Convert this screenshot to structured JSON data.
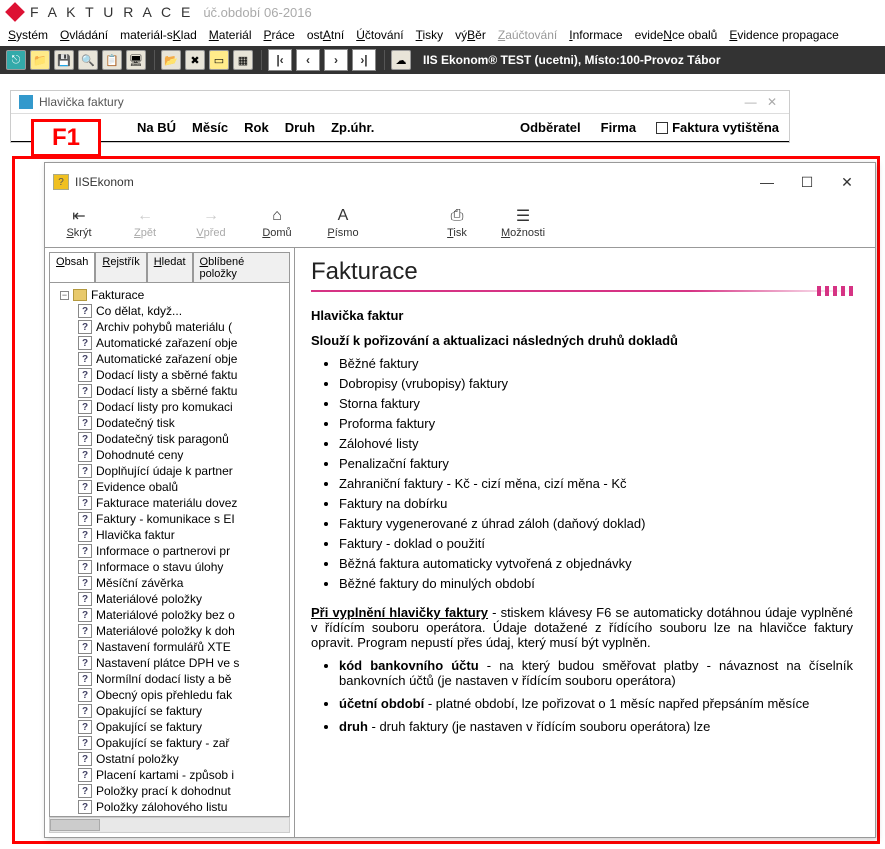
{
  "app": {
    "title": "F A K T U R A C E",
    "period": "úč.období 06-2016"
  },
  "menu": {
    "items": [
      {
        "label": "Systém",
        "u": "S"
      },
      {
        "label": "Ovládání",
        "u": "O"
      },
      {
        "label": "materiál-sKlad",
        "u": "K"
      },
      {
        "label": "Materiál",
        "u": "M"
      },
      {
        "label": "Práce",
        "u": "P"
      },
      {
        "label": "ostAtní",
        "u": "A"
      },
      {
        "label": "Účtování",
        "u": "Ú"
      },
      {
        "label": "Tisky",
        "u": "T"
      },
      {
        "label": "výBěr",
        "u": "B"
      },
      {
        "label": "Zaúčtování",
        "u": "Z",
        "disabled": true
      },
      {
        "label": "Informace",
        "u": "I"
      },
      {
        "label": "evideNce obalů",
        "u": "N"
      },
      {
        "label": "Evidence propagace",
        "u": "E"
      }
    ]
  },
  "dark_toolbar": {
    "status": "IIS Ekonom® TEST (ucetni), Místo:100-Provoz Tábor"
  },
  "hlavicka": {
    "window_title": "Hlavička faktury",
    "cols": [
      "Na BÚ",
      "Měsíc",
      "Rok",
      "Druh",
      "Zp.úhr."
    ],
    "right_cols": [
      "Odběratel",
      "Firma"
    ],
    "checkbox": "Faktura vytištěna",
    "f1": "F1"
  },
  "help": {
    "window_title": "IISEkonom",
    "toolbar": [
      {
        "label": "Skrýt",
        "icon": "⇤",
        "enabled": true
      },
      {
        "label": "Zpět",
        "icon": "←",
        "enabled": false
      },
      {
        "label": "Vpřed",
        "icon": "→",
        "enabled": false
      },
      {
        "label": "Domů",
        "icon": "⌂",
        "enabled": true
      },
      {
        "label": "Písmo",
        "icon": "A",
        "enabled": true
      },
      {
        "label": "Tisk",
        "icon": "⎙",
        "enabled": true
      },
      {
        "label": "Možnosti",
        "icon": "☰",
        "enabled": true
      }
    ],
    "tabs": [
      "Obsah",
      "Rejstřík",
      "Hledat",
      "Oblíbené položky"
    ],
    "tree_root": "Fakturace",
    "tree_items": [
      "Co dělat, když...",
      "Archiv pohybů materiálu (",
      "Automatické zařazení obje",
      "Automatické zařazení obje",
      "Dodací listy a sběrné faktu",
      "Dodací listy a sběrné faktu",
      "Dodací listy pro komukaci",
      "Dodatečný tisk",
      "Dodatečný tisk paragonů",
      "Dohodnuté ceny",
      "Doplňující údaje k partner",
      "Evidence obalů",
      "Fakturace materiálu dovez",
      "Faktury - komunikace s EI",
      "Hlavička faktur",
      "Informace o partnerovi pr",
      "Informace o stavu úlohy",
      "Měsíční závěrka",
      "Materiálové položky",
      "Materiálové položky bez o",
      "Materiálové položky k doh",
      "Nastavení formulářů XTE",
      "Nastavení plátce DPH ve s",
      "Normílní dodací listy a bě",
      "Obecný opis přehledu fak",
      "Opakující se faktury",
      "Opakující se faktury",
      "Opakující se faktury - zař",
      "Ostatní položky",
      "Placení kartami - způsob i",
      "Položky prací k dohodnut",
      "Položky zálohového listu"
    ],
    "content": {
      "h1": "Fakturace",
      "h3": "Hlavička faktur",
      "intro": "Slouží k pořizování a aktualizaci následných druhů dokladů",
      "bullets": [
        "Běžné faktury",
        "Dobropisy (vrubopisy) faktury",
        "Storna faktury",
        "Proforma faktury",
        "Zálohové listy",
        "Penalizační faktury",
        "Zahraniční faktury - Kč - cizí měna, cizí měna - Kč",
        "Faktury na dobírku",
        "Faktury vygenerované z úhrad záloh (daňový doklad)",
        "Faktury - doklad o použití",
        "Běžná faktura automaticky vytvořená z objednávky",
        "Běžné faktury do minulých období"
      ],
      "para_lead": "Při vyplnění hlavičky faktury",
      "para_rest": " - stiskem klávesy F6 se automaticky dotáhnou údaje vyplněné v řídícím souboru operátora. Údaje dotažené z řídícího souboru lze na hlavičce faktury opravit. Program nepustí přes údaj, který musí být vyplněn.",
      "defs": [
        {
          "term": "kód bankovního účtu",
          "text": " - na který budou směřovat platby - návaznost na číselník bankovních účtů (je nastaven v řídícím souboru operátora)"
        },
        {
          "term": "účetní období",
          "text": " - platné období, lze pořizovat o 1 měsíc napřed přepsáním měsíce"
        },
        {
          "term": "druh",
          "text": " - druh faktury (je nastaven v řídícím souboru operátora) lze"
        }
      ]
    }
  }
}
